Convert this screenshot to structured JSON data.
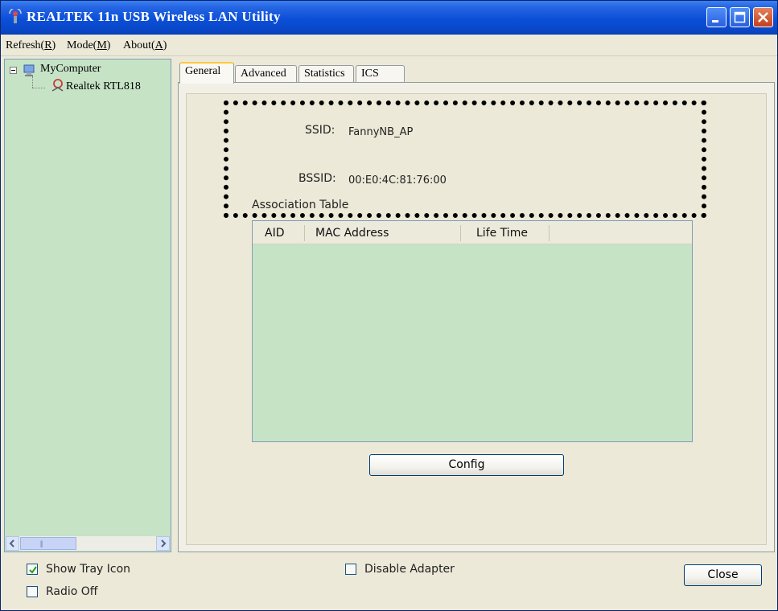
{
  "window": {
    "title": "REALTEK 11n USB Wireless LAN Utility"
  },
  "menu": [
    {
      "text": "Refresh(",
      "key": "R",
      "suffix": ")"
    },
    {
      "text": "Mode(",
      "key": "M",
      "suffix": ")"
    },
    {
      "text": "About(",
      "key": "A",
      "suffix": ")"
    }
  ],
  "tree": {
    "root": "MyComputer",
    "child": "Realtek RTL818"
  },
  "tabs": [
    "General",
    "Advanced",
    "Statistics",
    "ICS"
  ],
  "general": {
    "ssid_label": "SSID:",
    "ssid_value": "FannyNB_AP",
    "bssid_label": "BSSID:",
    "bssid_value": "00:E0:4C:81:76:00",
    "assoc_title": "Association Table",
    "columns": [
      "AID",
      "MAC Address",
      "Life Time"
    ],
    "config_button": "Config"
  },
  "bottom": {
    "show_tray_icon": {
      "label": "Show Tray Icon",
      "checked": true
    },
    "radio_off": {
      "label": "Radio Off",
      "checked": false
    },
    "disable_adapter": {
      "label": "Disable Adapter",
      "checked": false
    },
    "close_button": "Close"
  },
  "colors": {
    "titlebar": "#0b4fd8",
    "panel_green": "#c6e3c6",
    "window_bg": "#ece9d8",
    "tab_highlight": "#ffc83c"
  }
}
